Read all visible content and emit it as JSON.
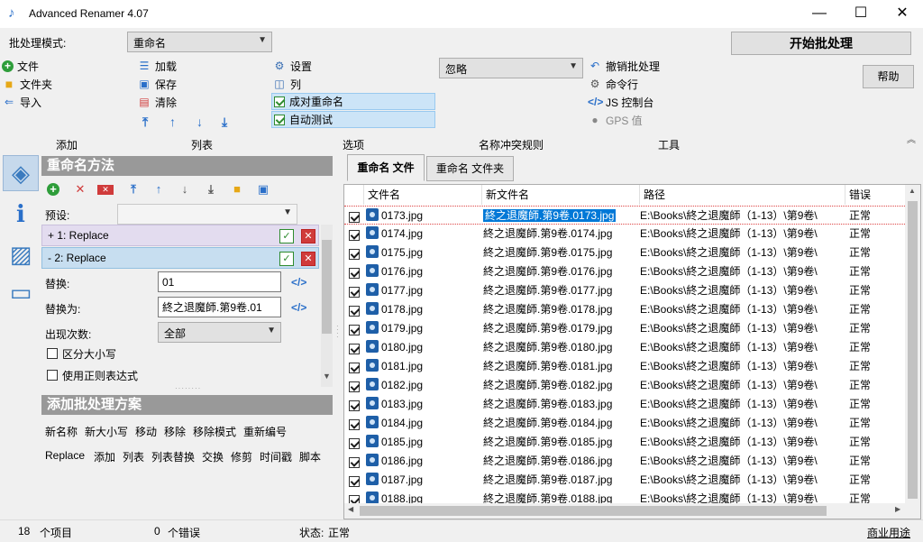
{
  "window": {
    "title": "Advanced Renamer 4.07",
    "minimize": "—",
    "maximize": "☐",
    "close": "✕"
  },
  "toolbar": {
    "batch_mode_label": "批处理模式:",
    "batch_mode_value": "重命名",
    "add": {
      "file": "文件",
      "folder": "文件夹",
      "import": "导入"
    },
    "list": {
      "load": "加载",
      "save": "保存",
      "clear": "清除"
    },
    "options": {
      "settings": "设置",
      "columns": "列",
      "pair_rename": "成对重命名",
      "auto_test": "自动测试"
    },
    "conflict_value": "忽略",
    "tools": {
      "undo_batch": "撤销批处理",
      "command_line": "命令行",
      "js_console": "JS 控制台",
      "gps": "GPS 值"
    },
    "start_button": "开始批处理",
    "help_button": "帮助",
    "sections": {
      "add": "添加",
      "list": "列表",
      "options": "选项",
      "conflict": "名称冲突规则",
      "tools": "工具"
    }
  },
  "methods_panel": {
    "header": "重命名方法",
    "preset_label": "预设:",
    "preset_value": "",
    "items": [
      {
        "label": "+ 1: Replace"
      },
      {
        "label": "- 2: Replace"
      }
    ],
    "replace_label": "替换:",
    "replace_value": "01",
    "replace_with_label": "替换为:",
    "replace_with_value": "終之退魔師.第9卷.01",
    "occurrence_label": "出现次数:",
    "occurrence_value": "全部",
    "case_sensitive": "区分大小写",
    "use_regex": "使用正则表达式"
  },
  "add_method_panel": {
    "header": "添加批处理方案",
    "row1": [
      "新名称",
      "新大小写",
      "移动",
      "移除",
      "移除模式",
      "重新编号"
    ],
    "row2": [
      "Replace",
      "添加",
      "列表",
      "列表替换",
      "交换",
      "修剪",
      "时间戳",
      "脚本"
    ]
  },
  "tabs": [
    "重命名 文件",
    "重命名 文件夹"
  ],
  "grid": {
    "columns": [
      "文件名",
      "新文件名",
      "路径",
      "错误"
    ],
    "rows": [
      {
        "name": "0173.jpg",
        "new": "終之退魔師.第9卷.0173.jpg",
        "path": "E:\\Books\\終之退魔師（1-13）\\第9卷\\",
        "err": "正常"
      },
      {
        "name": "0174.jpg",
        "new": "終之退魔師.第9卷.0174.jpg",
        "path": "E:\\Books\\終之退魔師（1-13）\\第9卷\\",
        "err": "正常"
      },
      {
        "name": "0175.jpg",
        "new": "終之退魔師.第9卷.0175.jpg",
        "path": "E:\\Books\\終之退魔師（1-13）\\第9卷\\",
        "err": "正常"
      },
      {
        "name": "0176.jpg",
        "new": "終之退魔師.第9卷.0176.jpg",
        "path": "E:\\Books\\終之退魔師（1-13）\\第9卷\\",
        "err": "正常"
      },
      {
        "name": "0177.jpg",
        "new": "終之退魔師.第9卷.0177.jpg",
        "path": "E:\\Books\\終之退魔師（1-13）\\第9卷\\",
        "err": "正常"
      },
      {
        "name": "0178.jpg",
        "new": "終之退魔師.第9卷.0178.jpg",
        "path": "E:\\Books\\終之退魔師（1-13）\\第9卷\\",
        "err": "正常"
      },
      {
        "name": "0179.jpg",
        "new": "終之退魔師.第9卷.0179.jpg",
        "path": "E:\\Books\\終之退魔師（1-13）\\第9卷\\",
        "err": "正常"
      },
      {
        "name": "0180.jpg",
        "new": "終之退魔師.第9卷.0180.jpg",
        "path": "E:\\Books\\終之退魔師（1-13）\\第9卷\\",
        "err": "正常"
      },
      {
        "name": "0181.jpg",
        "new": "終之退魔師.第9卷.0181.jpg",
        "path": "E:\\Books\\終之退魔師（1-13）\\第9卷\\",
        "err": "正常"
      },
      {
        "name": "0182.jpg",
        "new": "終之退魔師.第9卷.0182.jpg",
        "path": "E:\\Books\\終之退魔師（1-13）\\第9卷\\",
        "err": "正常"
      },
      {
        "name": "0183.jpg",
        "new": "終之退魔師.第9卷.0183.jpg",
        "path": "E:\\Books\\終之退魔師（1-13）\\第9卷\\",
        "err": "正常"
      },
      {
        "name": "0184.jpg",
        "new": "終之退魔師.第9卷.0184.jpg",
        "path": "E:\\Books\\終之退魔師（1-13）\\第9卷\\",
        "err": "正常"
      },
      {
        "name": "0185.jpg",
        "new": "終之退魔師.第9卷.0185.jpg",
        "path": "E:\\Books\\終之退魔師（1-13）\\第9卷\\",
        "err": "正常"
      },
      {
        "name": "0186.jpg",
        "new": "終之退魔師.第9卷.0186.jpg",
        "path": "E:\\Books\\終之退魔師（1-13）\\第9卷\\",
        "err": "正常"
      },
      {
        "name": "0187.jpg",
        "new": "終之退魔師.第9卷.0187.jpg",
        "path": "E:\\Books\\終之退魔師（1-13）\\第9卷\\",
        "err": "正常"
      },
      {
        "name": "0188.jpg",
        "new": "終之退魔師.第9卷.0188.jpg",
        "path": "E:\\Books\\終之退魔師（1-13）\\第9卷\\",
        "err": "正常"
      }
    ]
  },
  "status": {
    "items_count": "18",
    "items_label": "个项目",
    "errors_count": "0",
    "errors_label": "个错误",
    "state_label": "状态:",
    "state_value": "正常",
    "commercial": "商业用途"
  },
  "colors": {
    "accent": "#0078d7",
    "panel_header": "#999999",
    "selected_method": "#c7def0"
  }
}
